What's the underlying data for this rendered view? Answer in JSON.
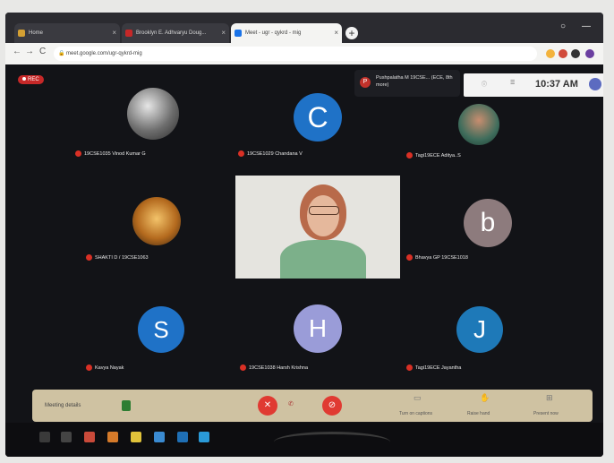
{
  "browser": {
    "tabs": [
      {
        "label": "Home",
        "fav_color": "#d4a033"
      },
      {
        "label": "Brooklyn E. Adhvaryu Doug...",
        "fav_color": "#c62828"
      },
      {
        "label": "Meet - ugr - qykrd - mig",
        "fav_color": "#1a73e8"
      }
    ],
    "new_tab": "+",
    "window_controls": [
      "○",
      "—"
    ],
    "url": "meet.google.com/ugr-qykrd-mig",
    "nav": [
      "←",
      "→",
      "C"
    ]
  },
  "meet": {
    "rec": "REC",
    "presenting": {
      "initial": "P",
      "text": "Pushpalatha M 19CSE... (ECE, 8th more)"
    },
    "clock": "10:37 AM",
    "top_icons": [
      "info-icon",
      "people-icon"
    ],
    "top_icon_glyphs": [
      "ⓘ",
      "☰"
    ],
    "participants": [
      {
        "name": "19CSE1035 Vinod Kumar G",
        "type": "photo",
        "color": "#8a8a8a"
      },
      {
        "name": "19CSE1029 Chandana V",
        "type": "initial",
        "initial": "C",
        "color": "#1f72c7"
      },
      {
        "name": "Tagi19ECE Aditya..S",
        "type": "photo",
        "color": "#2a8c5a"
      },
      {
        "name": "SHAKTI D / 19CSE1063",
        "type": "photo",
        "color": "#d98a2a"
      },
      {
        "name": "Bhavya GP 19CSE1018",
        "type": "initial",
        "initial": "b",
        "color": "#8d7b7d"
      },
      {
        "name": "Kavya Nayak",
        "type": "initial",
        "initial": "S",
        "color": "#1f72c7"
      },
      {
        "name": "19CSE1038 Harsh Krishna",
        "type": "initial",
        "initial": "H",
        "color": "#9a9cd8"
      },
      {
        "name": "Tagi19ECE Jayantha",
        "type": "initial",
        "initial": "J",
        "color": "#1e79b8"
      }
    ],
    "controls": {
      "meeting_details": "Meeting details",
      "mic_icon": "✕",
      "cam_icon": "⊘",
      "present": "Present now",
      "captions": "Turn on captions",
      "raise": "Raise hand"
    }
  }
}
